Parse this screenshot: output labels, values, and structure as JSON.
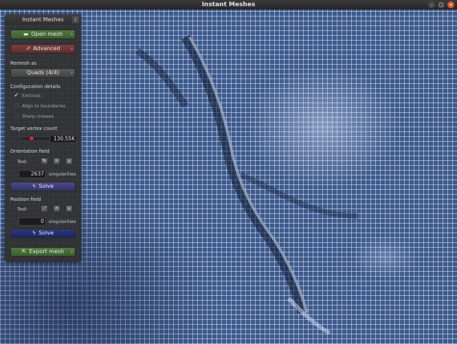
{
  "window": {
    "title": "Instant Meshes",
    "controls": [
      "–",
      "□",
      "×"
    ]
  },
  "panel": {
    "title": "Instant Meshes",
    "info_icon": "i",
    "open_mesh": "Open mesh",
    "advanced": "Advanced",
    "remesh_as_label": "Remesh as",
    "remesh_as_value": "Quads (4/4)",
    "config_label": "Configuration details",
    "options": [
      {
        "label": "Extrinsic",
        "checked": true
      },
      {
        "label": "Align to boundaries",
        "checked": false
      },
      {
        "label": "Sharp creases",
        "checked": false
      }
    ],
    "target_label": "Target vertex count",
    "target_value": "130.55K",
    "orientation_label": "Orientation field",
    "orientation_tool_label": "Tool:",
    "orientation_singularities": "2637",
    "orientation_singularities_label": "singularities",
    "orientation_solve": "Solve",
    "position_label": "Position field",
    "position_tool_label": "Tool:",
    "position_singularities": "0",
    "position_singularities_label": "singularities",
    "position_solve": "Solve",
    "export_mesh": "Export mesh"
  },
  "icons": {
    "open": "folder-icon",
    "advanced": "rocket-icon",
    "chevron": "chevron-right-icon",
    "solve": "bolt-icon",
    "export": "export-icon"
  },
  "colors": {
    "mesh_base": "#3d5a8c",
    "panel_bg": "#303030",
    "green_button": "#4f7a3f",
    "red_button": "#7a3f3f",
    "blue_button": "#1d2663"
  }
}
